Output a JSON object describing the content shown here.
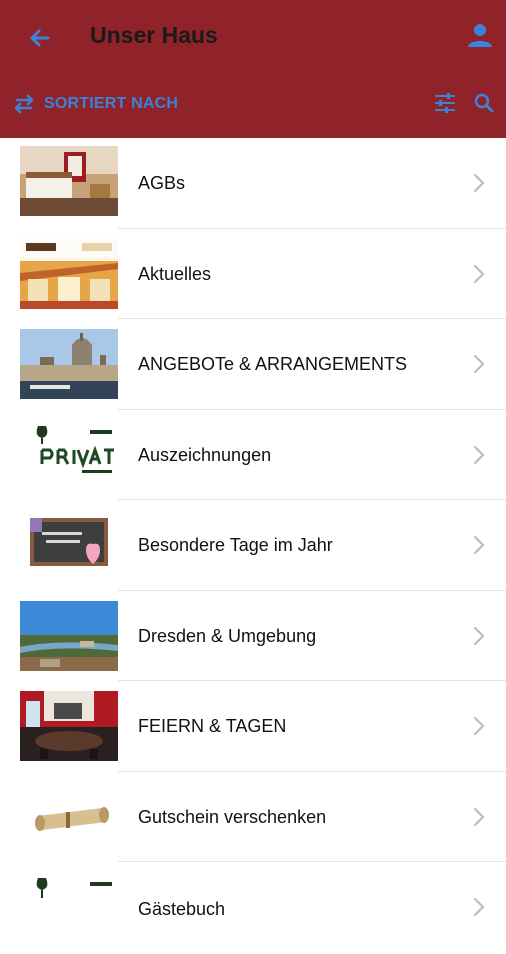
{
  "header": {
    "title": "Unser Haus",
    "back_icon": "arrow-left-icon",
    "user_icon": "person-icon",
    "sort_label": "SORTIERT NACH",
    "sort_icon": "swap-arrows-icon",
    "filter_icon": "sliders-icon",
    "search_icon": "search-icon",
    "bar_color": "#90222a",
    "accent_color": "#3b82d9"
  },
  "items": [
    {
      "label": "AGBs"
    },
    {
      "label": "Aktuelles"
    },
    {
      "label": "ANGEBOTe & ARRANGEMENTS"
    },
    {
      "label": "Auszeichnungen"
    },
    {
      "label": "Besondere Tage im Jahr"
    },
    {
      "label": "Dresden & Umgebung"
    },
    {
      "label": "FEIERN & TAGEN"
    },
    {
      "label": "Gutschein verschenken"
    },
    {
      "label": "Gästebuch"
    }
  ]
}
